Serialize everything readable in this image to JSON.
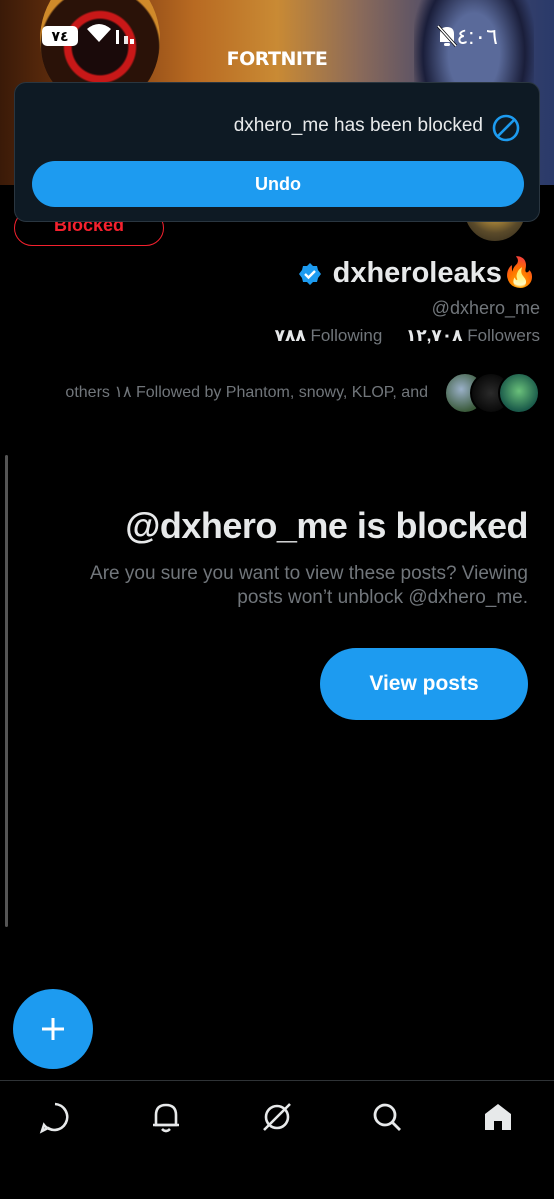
{
  "status_bar": {
    "time": "٤:٠٦",
    "battery": "٧٤",
    "icons": [
      "wifi-icon",
      "signal-icon",
      "mute-bell-icon"
    ]
  },
  "banner": {
    "brand": "FORTNITE"
  },
  "toast": {
    "message": "dxhero_me has been blocked",
    "undo_label": "Undo",
    "icon": "block-icon"
  },
  "profile": {
    "blocked_label": "Blocked",
    "display_name": "dxheroleaks🔥",
    "handle": "@dxhero_me",
    "following_count": "٧٨٨",
    "following_label": "Following",
    "followers_count": "١٢,٧٠٨",
    "followers_label": "Followers",
    "followed_by": "others ١٨ Followed by Phantom, snowy, KLOP, and"
  },
  "blocked_notice": {
    "title": "@dxhero_me is blocked",
    "description": "Are you sure you want to view these posts? Viewing posts won’t unblock @dxhero_me.",
    "view_posts_label": "View posts"
  },
  "bottom_nav": {
    "items": [
      "messages-icon",
      "notifications-icon",
      "grok-icon",
      "search-icon",
      "home-icon"
    ]
  },
  "colors": {
    "accent": "#1d9bf0",
    "blocked_red": "#f4212e",
    "background": "#000000",
    "muted_text": "#71767b"
  }
}
